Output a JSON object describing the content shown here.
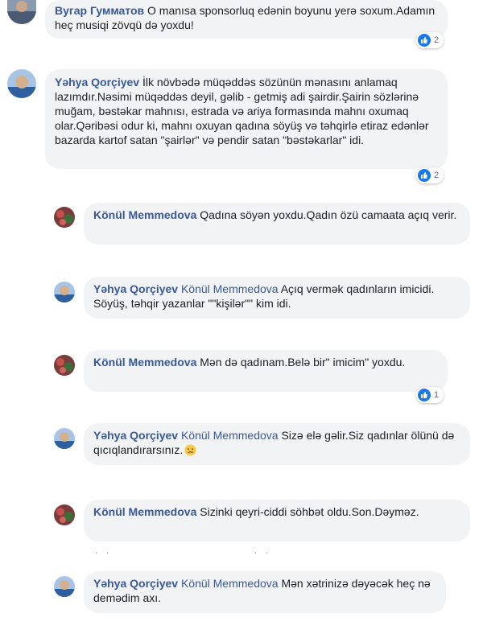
{
  "comments": [
    {
      "author": "Вугар Гумматов",
      "text": "O manısa sponsorluq edənin boyunu yerə soxum.Adamın heç musiqi zövqü də yoxdu!",
      "reactions": "2"
    },
    {
      "author": "Yəhya Qorçiyev",
      "text": "İlk növbədə müqəddəs sözünün mənasını anlamaq lazımdır.Nəsimi müqəddəs deyil, gəlib - getmiş adi şairdir.Şairin sözlərinə muğam, bəstəkar mahnısı, estrada və ariya formasında mahnı oxumaq olar.Qəribəsi odur ki, mahnı oxuyan qadına söyüş və təhqirlə etiraz edənlər bazarda kartof satan \"şairlər\" və pendir satan \"bəstəkarlar\" idi.",
      "reactions": "2"
    }
  ],
  "replies": [
    {
      "author": "Könül Memmedova",
      "mention": "",
      "text": "Qadına söyən yoxdu.Qadın özü camaata açıq verir.",
      "reactions": ""
    },
    {
      "author": "Yəhya Qorçiyev",
      "mention": "Könül Memmedova",
      "text": "Açıq vermək qadınların imicidi. Söyüş, təhqir yazanlar \"\"kişilər\"\" kim idi.",
      "reactions": ""
    },
    {
      "author": "Könül Memmedova",
      "mention": "",
      "text": "Mən də qadınam.Belə bir\" imicim\" yoxdu.",
      "reactions": "1"
    },
    {
      "author": "Yəhya Qorçiyev",
      "mention": "Könül Memmedova",
      "text": "Sizə elə gəlir.Siz qadınlar ölünü də qıcıqlandırarsınız.",
      "emoji": "sad-face-emoji",
      "reactions": ""
    },
    {
      "author": "Könül Memmedova",
      "mention": "",
      "text": "Sizinki qeyri-ciddi söhbət oldu.Son.Dəyməz.",
      "reactions": ""
    },
    {
      "author": "Yəhya Qorçiyev",
      "mention": "Könül Memmedova",
      "text": "Mən xətrinizə dəyəcək heç nə demədim axı.",
      "reactions": ""
    }
  ],
  "colors": {
    "author": "#385898",
    "bubble": "#f2f3f5",
    "like": "#1877f2"
  }
}
